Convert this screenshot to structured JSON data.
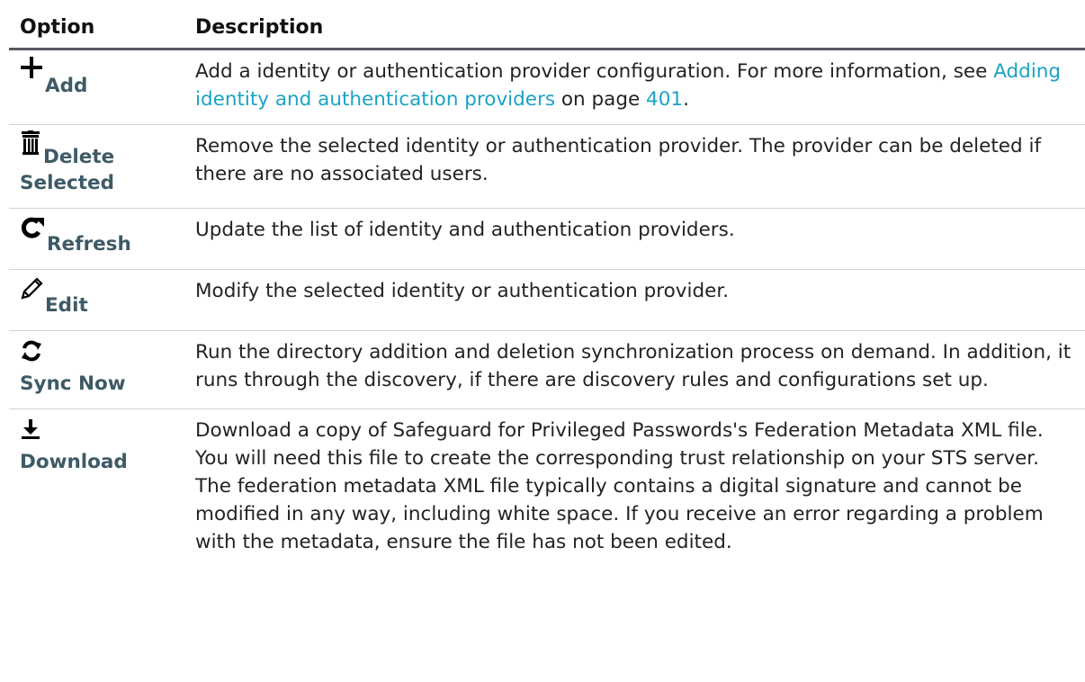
{
  "header": {
    "option_label": "Option",
    "description_label": "Description"
  },
  "rows": [
    {
      "icon": "plus-icon",
      "label": "Add",
      "desc_before": "Add a identity or authentication provider configuration. For more information, see ",
      "link_text": "Adding identity and authentication providers",
      "desc_middle": " on page ",
      "page_link": "401",
      "desc_after": "."
    },
    {
      "icon": "trash-icon",
      "label_line1": "Delete",
      "label_line2": "Selected",
      "desc": "Remove the selected identity or authentication provider. The provider can be deleted if there are no associated users."
    },
    {
      "icon": "refresh-icon",
      "label": "Refresh",
      "desc": "Update the list of identity and authentication providers."
    },
    {
      "icon": "pencil-icon",
      "label": "Edit",
      "desc": "Modify the selected identity or authentication provider."
    },
    {
      "icon": "sync-icon",
      "label": "Sync Now",
      "desc": "Run the directory addition and deletion synchronization process on demand. In addition, it runs through the discovery, if there are discovery rules and configurations set up."
    },
    {
      "icon": "download-icon",
      "label": "Download",
      "desc": "Download a copy of Safeguard for Privileged Passwords's Federation Metadata XML file. You will need this file to create the corresponding trust relationship on your STS server. The federation metadata XML file typically contains a digital signature and cannot be modified in any way, including white space. If you receive an error regarding a problem with the metadata, ensure the file has not been edited."
    }
  ]
}
